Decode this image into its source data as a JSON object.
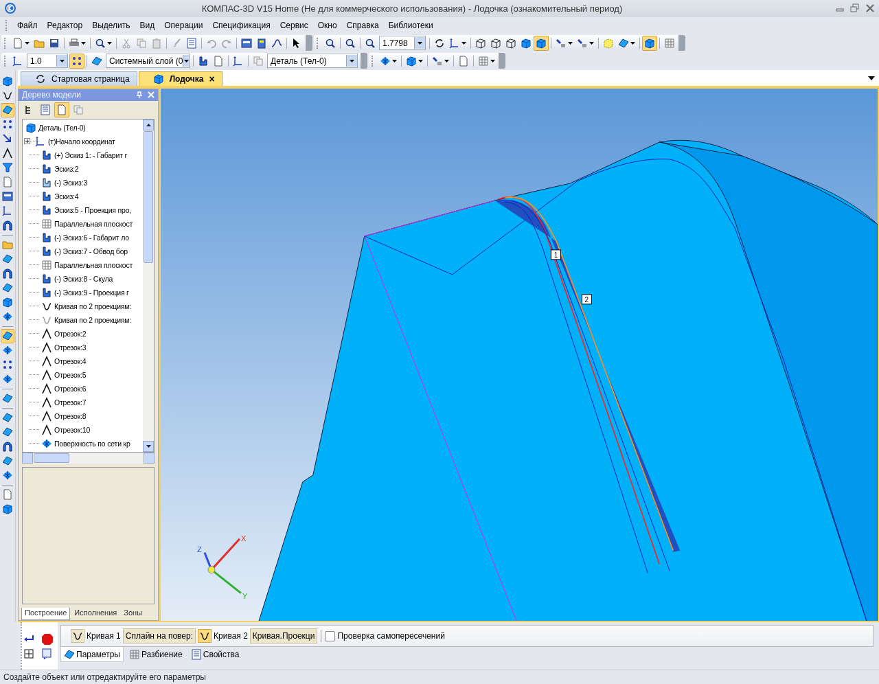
{
  "window": {
    "title": "КОМПАС-3D V15 Home (Не для коммерческого использования) - Лодочка (ознакомительный период)"
  },
  "menu": [
    "Файл",
    "Редактор",
    "Выделить",
    "Вид",
    "Операции",
    "Спецификация",
    "Сервис",
    "Окно",
    "Справка",
    "Библиотеки"
  ],
  "toolbar_main": {
    "groups": [
      [
        {
          "kind": "page",
          "pressed": false,
          "menu": true
        },
        {
          "kind": "folder",
          "pressed": false,
          "menu": false
        },
        {
          "kind": "disk",
          "pressed": false,
          "menu": false
        }
      ],
      [
        {
          "kind": "printer",
          "pressed": false,
          "menu": true
        }
      ],
      [
        {
          "kind": "magnifier",
          "pressed": false,
          "menu": true
        }
      ],
      [
        {
          "kind": "scissors",
          "pressed": false,
          "menu": false
        },
        {
          "kind": "copy",
          "pressed": false,
          "menu": false
        },
        {
          "kind": "clipboard",
          "pressed": false,
          "menu": false
        }
      ],
      [
        {
          "kind": "brush",
          "pressed": false,
          "menu": false
        },
        {
          "kind": "list",
          "pressed": false,
          "menu": false
        }
      ],
      [
        {
          "kind": "undo",
          "pressed": false,
          "menu": false
        },
        {
          "kind": "redo",
          "pressed": false,
          "menu": false
        }
      ],
      [
        {
          "kind": "window",
          "pressed": false,
          "menu": false
        },
        {
          "kind": "calculator",
          "pressed": false,
          "menu": false
        },
        {
          "kind": "function",
          "pressed": false,
          "menu": false
        }
      ],
      [
        {
          "kind": "cursor",
          "pressed": false,
          "menu": false
        }
      ]
    ]
  },
  "toolbar_view": {
    "groups": [
      [
        {
          "kind": "magnifier",
          "pressed": false,
          "menu": false
        }
      ],
      [
        {
          "kind": "magnifier",
          "pressed": false,
          "menu": false
        }
      ],
      [
        {
          "kind": "magnifier",
          "pressed": false,
          "menu": false
        }
      ]
    ],
    "zoom_value": "1.7798",
    "groups_after": [
      [
        {
          "kind": "rotate",
          "pressed": false,
          "menu": false
        },
        {
          "kind": "axes",
          "pressed": false,
          "menu": true
        }
      ],
      [
        {
          "kind": "wire",
          "pressed": false,
          "menu": false
        },
        {
          "kind": "wire",
          "pressed": false,
          "menu": false
        },
        {
          "kind": "wire",
          "pressed": false,
          "menu": false
        },
        {
          "kind": "cube",
          "pressed": false,
          "menu": false
        },
        {
          "kind": "cube",
          "pressed": true,
          "menu": false
        }
      ],
      [
        {
          "kind": "lamp",
          "pressed": false,
          "menu": true
        },
        {
          "kind": "lamp",
          "pressed": false,
          "menu": true
        }
      ],
      [
        {
          "kind": "dashed-box",
          "pressed": false,
          "menu": false
        },
        {
          "kind": "surface",
          "pressed": false,
          "menu": true
        }
      ],
      [
        {
          "kind": "cube",
          "pressed": true,
          "menu": false
        }
      ],
      [
        {
          "kind": "grid",
          "pressed": false,
          "menu": false
        }
      ]
    ]
  },
  "toolbar_current": {
    "step_value": "1.0",
    "snap_pressed": true,
    "layer_value": "Системный слой (0",
    "part_value": "Деталь (Тел-0)",
    "groups": [
      [
        {
          "kind": "sketch",
          "pressed": false,
          "menu": false
        },
        {
          "kind": "page",
          "pressed": false,
          "menu": false
        }
      ],
      [
        {
          "kind": "axes",
          "pressed": false,
          "menu": false
        }
      ]
    ],
    "groups_after": [
      [
        {
          "kind": "mesh",
          "pressed": false,
          "menu": true
        }
      ],
      [
        {
          "kind": "cube",
          "pressed": false,
          "menu": true
        }
      ],
      [
        {
          "kind": "lamp",
          "pressed": false,
          "menu": true
        }
      ],
      [
        {
          "kind": "page",
          "pressed": false,
          "menu": false
        }
      ],
      [
        {
          "kind": "grid",
          "pressed": false,
          "menu": true
        }
      ]
    ]
  },
  "left_toolbar": {
    "groups": [
      [
        {
          "kind": "cube",
          "pressed": false
        },
        {
          "kind": "curve",
          "pressed": false
        },
        {
          "kind": "surface",
          "pressed": true
        },
        {
          "kind": "dots",
          "pressed": false
        },
        {
          "kind": "arrow",
          "pressed": false
        },
        {
          "kind": "angle",
          "pressed": false
        },
        {
          "kind": "funnel",
          "pressed": false
        },
        {
          "kind": "page",
          "pressed": false
        },
        {
          "kind": "window",
          "pressed": false
        },
        {
          "kind": "axes",
          "pressed": false
        },
        {
          "kind": "arch",
          "pressed": false
        }
      ],
      [
        {
          "kind": "folder",
          "pressed": false
        },
        {
          "kind": "surface",
          "pressed": false
        },
        {
          "kind": "arch",
          "pressed": false
        },
        {
          "kind": "surface",
          "pressed": false
        },
        {
          "kind": "cube",
          "pressed": false
        },
        {
          "kind": "mesh",
          "pressed": false
        }
      ],
      [
        {
          "kind": "surface",
          "pressed": true
        },
        {
          "kind": "mesh",
          "pressed": false
        },
        {
          "kind": "dots",
          "pressed": false
        },
        {
          "kind": "mesh",
          "pressed": false
        }
      ],
      [
        {
          "kind": "surface",
          "pressed": false
        }
      ],
      [
        {
          "kind": "surface",
          "pressed": false
        },
        {
          "kind": "surface",
          "pressed": false
        },
        {
          "kind": "arch",
          "pressed": false
        },
        {
          "kind": "surface",
          "pressed": false
        },
        {
          "kind": "mesh",
          "pressed": false
        }
      ],
      [
        {
          "kind": "page",
          "pressed": false
        },
        {
          "kind": "cube",
          "pressed": false
        }
      ]
    ]
  },
  "doc_tabs": [
    {
      "label": "Стартовая страница",
      "selected": false,
      "kind": "home",
      "closable": false
    },
    {
      "label": "Лодочка",
      "selected": true,
      "kind": "part",
      "closable": true,
      "close_label": "×"
    }
  ],
  "tree_panel": {
    "title": "Дерево модели",
    "tools": [
      {
        "kind": "tree",
        "pressed": false
      },
      {
        "kind": "list",
        "pressed": false
      },
      {
        "kind": "page",
        "pressed": true
      },
      {
        "kind": "copy",
        "pressed": false
      }
    ],
    "tree": [
      {
        "label": "Деталь (Тел-0)",
        "kind": "part",
        "children": [
          {
            "label": "(т)Начало координат",
            "kind": "origin",
            "expanded": false,
            "has_children": true
          },
          {
            "label": "(+) Эскиз 1: - Габарит г",
            "kind": "sketch"
          },
          {
            "label": "Эскиз:2",
            "kind": "sketch"
          },
          {
            "label": "(-) Эскиз:3",
            "kind": "sketch-edited"
          },
          {
            "label": "Эскиз:4",
            "kind": "sketch"
          },
          {
            "label": "Эскиз:5 - Проекция про,",
            "kind": "sketch"
          },
          {
            "label": "Параллельная плоскост",
            "kind": "plane"
          },
          {
            "label": "(-) Эскиз:6 - Габарит ло",
            "kind": "sketch"
          },
          {
            "label": "(-) Эскиз:7 - Обвод бор",
            "kind": "sketch"
          },
          {
            "label": "Параллельная плоскост",
            "kind": "plane"
          },
          {
            "label": "(-) Эскиз:8 - Скула",
            "kind": "sketch"
          },
          {
            "label": "(-) Эскиз:9 - Проекция г",
            "kind": "sketch"
          },
          {
            "label": "Кривая по 2 проекциям:",
            "kind": "curve"
          },
          {
            "label": "Кривая по 2 проекциям:",
            "kind": "curve-dim"
          },
          {
            "label": "Отрезок:2",
            "kind": "segment"
          },
          {
            "label": "Отрезок:3",
            "kind": "segment"
          },
          {
            "label": "Отрезок:4",
            "kind": "segment"
          },
          {
            "label": "Отрезок:5",
            "kind": "segment"
          },
          {
            "label": "Отрезок:6",
            "kind": "segment"
          },
          {
            "label": "Отрезок:7",
            "kind": "segment"
          },
          {
            "label": "Отрезок:8",
            "kind": "segment"
          },
          {
            "label": "Отрезок:10",
            "kind": "segment"
          },
          {
            "label": "Поверхность по сети кр",
            "kind": "surface"
          }
        ]
      }
    ],
    "tabs": [
      {
        "label": "Построение",
        "selected": true
      },
      {
        "label": "Исполнения",
        "selected": false
      },
      {
        "label": "Зоны",
        "selected": false
      }
    ]
  },
  "viewport": {
    "tags": [
      {
        "label": "1"
      },
      {
        "label": "2"
      }
    ],
    "axes": [
      {
        "label": "X",
        "color": "#e03030"
      },
      {
        "label": "Y",
        "color": "#30b030"
      },
      {
        "label": "Z",
        "color": "#3050e0"
      }
    ]
  },
  "property_panel": {
    "fields": [
      {
        "label": "Кривая 1",
        "pressed": false,
        "value": "Сплайн на повер:"
      },
      {
        "label": "Кривая 2",
        "pressed": true,
        "value": "Кривая.Проекци"
      }
    ],
    "checkbox": {
      "label": "Проверка самопересечений",
      "checked": false
    },
    "tabs": [
      {
        "label": "Параметры",
        "selected": true,
        "kind": "surface"
      },
      {
        "label": "Разбиение",
        "selected": false,
        "kind": "grid"
      },
      {
        "label": "Свойства",
        "selected": false,
        "kind": "list"
      }
    ]
  },
  "status_bar": {
    "text": "Создайте объект или отредактируйте его параметры"
  }
}
